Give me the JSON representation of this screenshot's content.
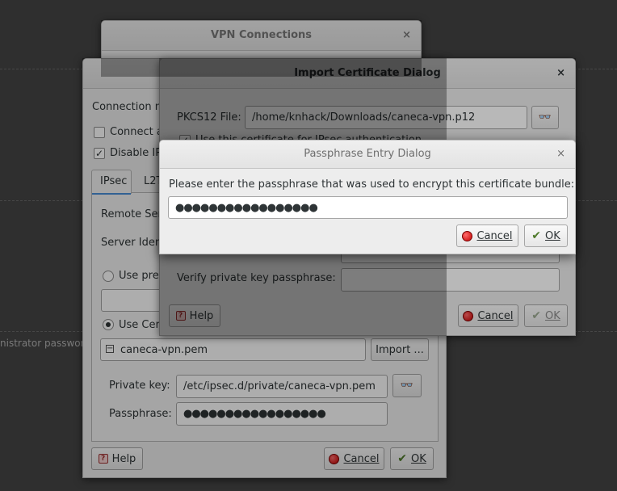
{
  "background": {
    "admin_text": "nistrator password"
  },
  "vpn_connections": {
    "title": "VPN Connections",
    "close": "×"
  },
  "editor": {
    "connection_label": "Connection n",
    "connect_auto_label": "Connect a",
    "disable_ipv6_label": "Disable IP",
    "tab_ipsec": "IPsec",
    "tab_l2tp": "L2T",
    "remote_server_label": "Remote Ser",
    "server_identity_label": "Server Iden",
    "use_psk_label": "Use pre-",
    "use_cert_label": "Use Cer",
    "cert_name": "caneca-vpn.pem",
    "import_button": "Import ...",
    "private_key_label": "Private key:",
    "private_key_value": "/etc/ipsec.d/private/caneca-vpn.pem",
    "passphrase_label": "Passphrase:",
    "passphrase_dots": "●●●●●●●●●●●●●●●●●",
    "help_button": "Help",
    "cancel_button": "Cancel",
    "ok_button": "OK"
  },
  "import_dialog": {
    "title": "Import Certificate Dialog",
    "close": "×",
    "pkcs12_label": "PKCS12 File:",
    "pkcs12_value": "/home/knhack/Downloads/caneca-vpn.p12",
    "use_cert_label": "Use this certificate for IPsec authentication",
    "verify_label": "Verify private key passphrase:",
    "help_button": "Help",
    "cancel_button": "Cancel",
    "ok_button": "OK"
  },
  "passphrase_dialog": {
    "title": "Passphrase Entry Dialog",
    "close": "×",
    "prompt": "Please enter the passphrase that was used to encrypt this certificate bundle:",
    "passphrase_dots": "●●●●●●●●●●●●●●●●●",
    "cancel_button": "Cancel",
    "ok_button": "OK"
  },
  "icons": [
    "close-icon",
    "binoculars-icon",
    "cancel-icon",
    "ok-icon",
    "help-icon",
    "checkbox-icon",
    "radio-icon"
  ],
  "colors": {
    "desktop": "#2f2f2f",
    "window": "#ededed",
    "cancel_red": "#c40000",
    "ok_green": "#4e7a2a"
  }
}
